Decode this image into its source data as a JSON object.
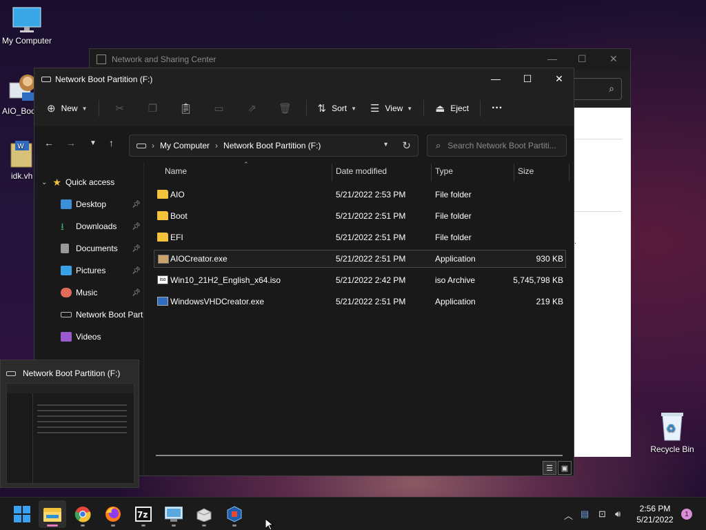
{
  "desktop": {
    "icons": [
      {
        "label": "My Computer",
        "icon": "monitor-icon"
      },
      {
        "label": "AIO_Boo",
        "icon": "aio-boot-icon"
      },
      {
        "label": "idk.vh",
        "icon": "vhd-file-icon"
      },
      {
        "label": "Recycle Bin",
        "icon": "recycle-bin-icon"
      }
    ]
  },
  "bg_window": {
    "title": "Network and Sharing Center",
    "partial_text": "t."
  },
  "window": {
    "title": "Network Boot Partition (F:)",
    "controls": {
      "minimize": "—",
      "maximize": "☐",
      "close": "✕"
    },
    "commands": {
      "new": "New",
      "sort": "Sort",
      "view": "View",
      "eject": "Eject",
      "more": "···"
    },
    "address": {
      "root": "My Computer",
      "current": "Network Boot Partition (F:)"
    },
    "search_placeholder": "Search Network Boot Partiti..."
  },
  "sidebar": {
    "quick_access": "Quick access",
    "items": [
      {
        "label": "Desktop",
        "pinned": true,
        "color": "#3a8fd8"
      },
      {
        "label": "Downloads",
        "pinned": true,
        "color": "#3fae6a"
      },
      {
        "label": "Documents",
        "pinned": true,
        "color": "#9a9a9a"
      },
      {
        "label": "Pictures",
        "pinned": true,
        "color": "#3aa0e8"
      },
      {
        "label": "Music",
        "pinned": true,
        "color": "#e36a5a"
      },
      {
        "label": "Network Boot Partition (F:)",
        "pinned": false,
        "color": "#bbbbbb"
      },
      {
        "label": "Videos",
        "pinned": false,
        "color": "#9b59d0"
      }
    ]
  },
  "columns": {
    "name": "Name",
    "date": "Date modified",
    "type": "Type",
    "size": "Size"
  },
  "files": [
    {
      "name": "AIO",
      "date": "5/21/2022 2:53 PM",
      "type": "File folder",
      "size": "",
      "icon": "folder-icon"
    },
    {
      "name": "Boot",
      "date": "5/21/2022 2:51 PM",
      "type": "File folder",
      "size": "",
      "icon": "folder-icon"
    },
    {
      "name": "EFI",
      "date": "5/21/2022 2:51 PM",
      "type": "File folder",
      "size": "",
      "icon": "folder-icon"
    },
    {
      "name": "AIOCreator.exe",
      "date": "5/21/2022 2:51 PM",
      "type": "Application",
      "size": "930 KB",
      "icon": "exe-icon"
    },
    {
      "name": "Win10_21H2_English_x64.iso",
      "date": "5/21/2022 2:42 PM",
      "type": "iso Archive",
      "size": "5,745,798 KB",
      "icon": "iso-icon"
    },
    {
      "name": "WindowsVHDCreator.exe",
      "date": "5/21/2022 2:51 PM",
      "type": "Application",
      "size": "219 KB",
      "icon": "exe-icon"
    }
  ],
  "preview": {
    "title": "Network Boot Partition (F:)"
  },
  "taskbar": {
    "apps": [
      "start-icon",
      "file-explorer-icon",
      "chrome-icon",
      "firefox-icon",
      "7zip-icon",
      "remote-desktop-icon",
      "setup-icon",
      "virtualbox-icon"
    ],
    "clock_time": "2:56 PM",
    "clock_date": "5/21/2022",
    "notifications": "1"
  }
}
